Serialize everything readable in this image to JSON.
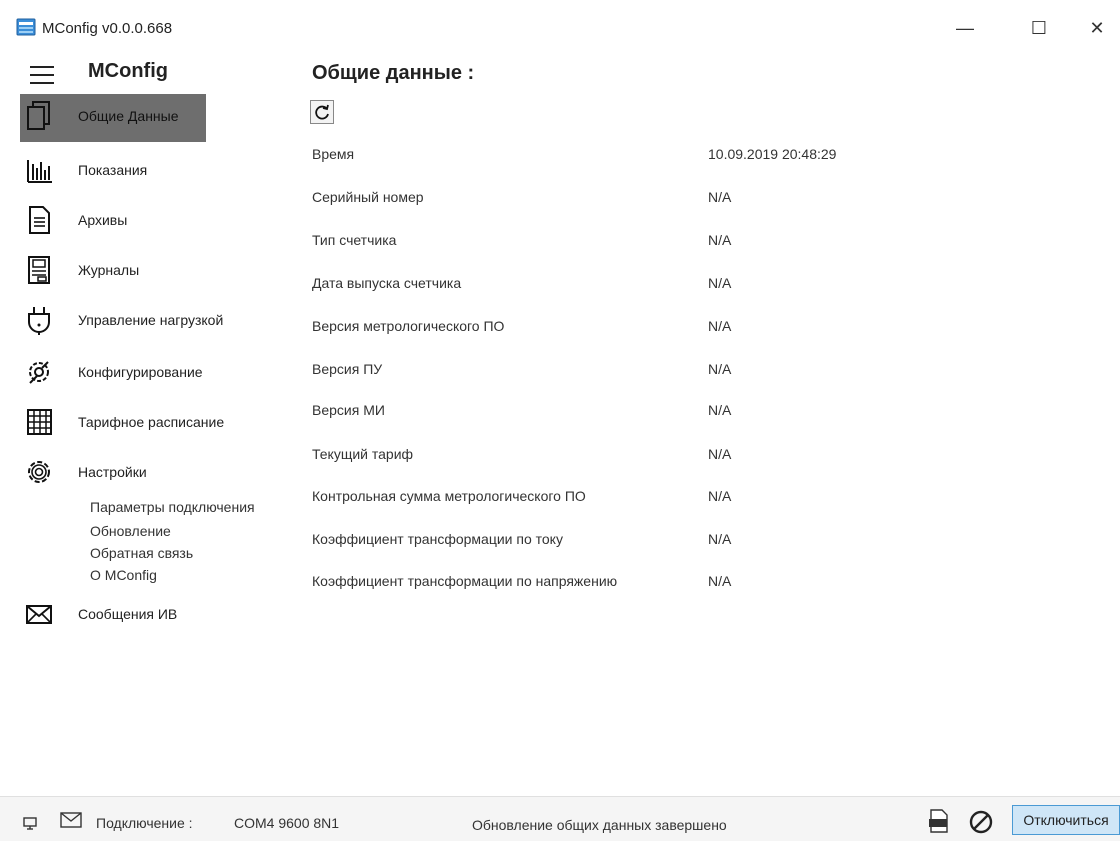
{
  "window": {
    "title": "MConfig v0.0.0.668",
    "minimize_glyph": "—",
    "maximize_glyph": "☐",
    "close_glyph": "✕"
  },
  "sidebar": {
    "app_name": "MConfig",
    "items": [
      {
        "label": "Общие Данные",
        "icon": "document-pages-icon",
        "active": true
      },
      {
        "label": "Показания",
        "icon": "bar-chart-icon",
        "active": false
      },
      {
        "label": "Архивы",
        "icon": "document-icon",
        "active": false
      },
      {
        "label": "Журналы",
        "icon": "journal-icon",
        "active": false
      },
      {
        "label": "Управление нагрузкой",
        "icon": "plug-icon",
        "active": false
      },
      {
        "label": "Конфигурирование",
        "icon": "tools-gear-icon",
        "active": false
      },
      {
        "label": "Тарифное расписание",
        "icon": "calendar-grid-icon",
        "active": false
      },
      {
        "label": "Настройки",
        "icon": "gear-icon",
        "active": false
      }
    ],
    "settings_subitems": [
      "Параметры подключения",
      "Обновление",
      "Обратная связь",
      "О MConfig"
    ],
    "messages_item": {
      "label": "Сообщения ИВ",
      "icon": "envelope-icon"
    }
  },
  "main": {
    "title": "Общие данные :",
    "rows": [
      {
        "label": "Время",
        "value": "10.09.2019 20:48:29"
      },
      {
        "label": "Серийный номер",
        "value": "N/A"
      },
      {
        "label": "Тип счетчика",
        "value": "N/A"
      },
      {
        "label": "Дата выпуска счетчика",
        "value": "N/A"
      },
      {
        "label": "Версия метрологического ПО",
        "value": "N/A"
      },
      {
        "label": "Версия ПУ",
        "value": "N/A"
      },
      {
        "label": "Версия МИ",
        "value": "N/A"
      },
      {
        "label": "Текущий тариф",
        "value": "N/A"
      },
      {
        "label": "Контрольная сумма метрологического ПО",
        "value": "N/A"
      },
      {
        "label": "Коэффициент трансформации по току",
        "value": "N/A"
      },
      {
        "label": "Коэффициент трансформации по напряжению",
        "value": "N/A"
      }
    ]
  },
  "statusbar": {
    "connection_label": "Подключение :",
    "connection_value": "COM4 9600 8N1",
    "status_text": "Обновление общих данных завершено",
    "disconnect_label": "Отключиться"
  },
  "colors": {
    "active_nav_bg": "#6e6e6e",
    "disconnect_bg": "#cfe6f7",
    "disconnect_border": "#4a9ad4"
  }
}
